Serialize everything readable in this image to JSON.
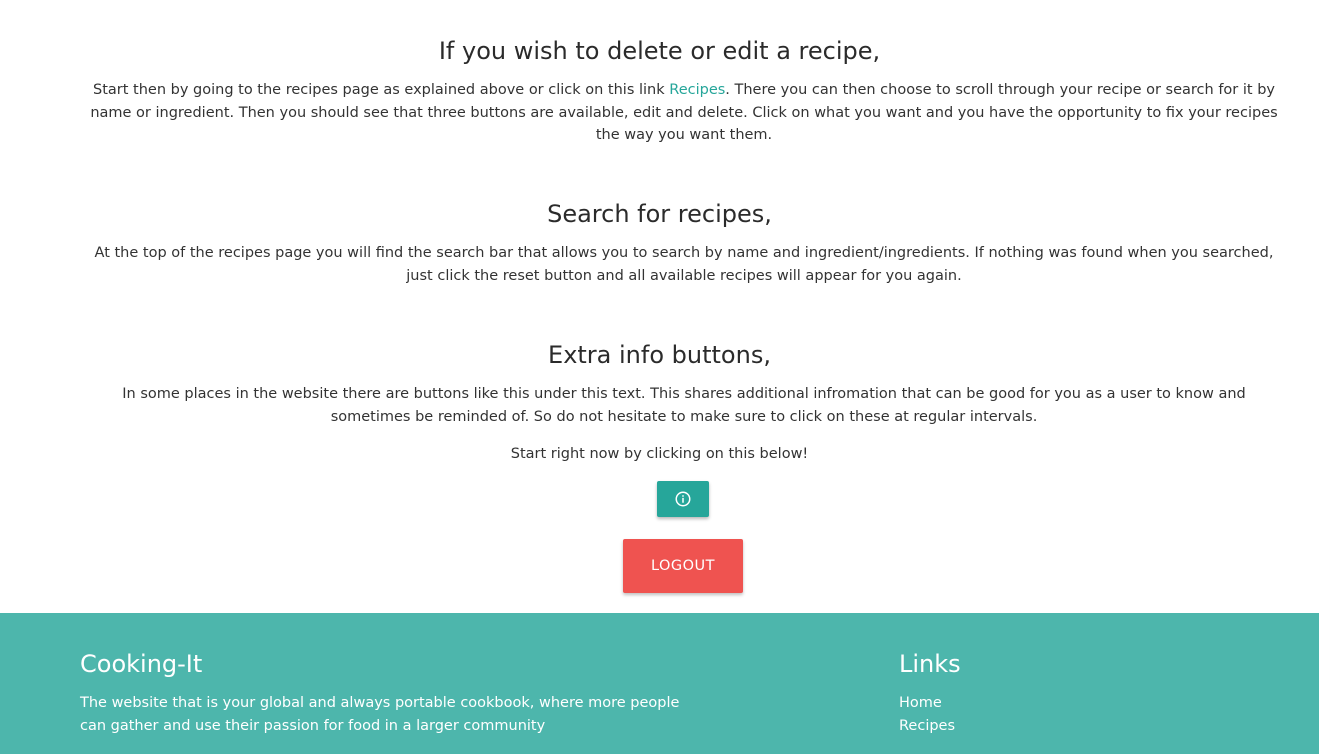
{
  "sections": {
    "delete_edit": {
      "title": "If you wish to delete or edit a recipe,",
      "text_before_link": "Start then by going to the recipes page as explained above or click on this link ",
      "link_label": "Recipes",
      "text_after_link": ". There you can then choose to scroll through your recipe or search for it by name or ingredient. Then you should see that three buttons are available, edit and delete. Click on what you want and you have the opportunity to fix your recipes the way you want them."
    },
    "search": {
      "title": "Search for recipes,",
      "text": "At the top of the recipes page you will find the search bar that allows you to search by name and ingredient/ingredients. If nothing was found when you searched, just click the reset button and all available recipes will appear for you again."
    },
    "extra_info": {
      "title": "Extra info buttons,",
      "text": "In some places in the website there are buttons like this under this text. This shares additional infromation that can be good for you as a user to know and sometimes be reminded of. So do not hesitate to make sure to click on these at regular intervals.",
      "start_text": "Start right now by clicking on this below!",
      "info_button_icon": "info-circle-icon"
    }
  },
  "logout_label": "LOGOUT",
  "footer": {
    "brand": "Cooking-It",
    "description": "The website that is your global and always portable cookbook, where more people can gather and use their passion for food in a larger community",
    "links_title": "Links",
    "links": [
      {
        "label": "Home"
      },
      {
        "label": "Recipes"
      }
    ]
  },
  "colors": {
    "primary_teal": "#26a69a",
    "footer_teal": "#4db6ac",
    "logout_red": "#ef5350"
  }
}
